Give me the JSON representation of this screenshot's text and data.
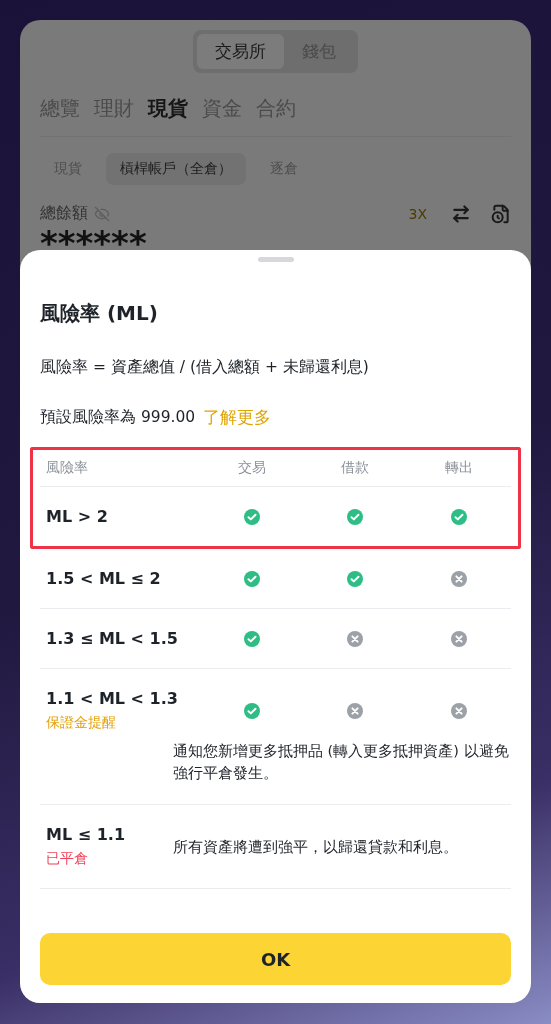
{
  "background_app": {
    "switch": [
      {
        "label": "交易所",
        "selected": true
      },
      {
        "label": "錢包",
        "selected": false
      }
    ],
    "tabs": [
      {
        "label": "總覽",
        "selected": false
      },
      {
        "label": "理財",
        "selected": false
      },
      {
        "label": "現貨",
        "selected": true
      },
      {
        "label": "資金",
        "selected": false
      },
      {
        "label": "合約",
        "selected": false
      }
    ],
    "subtabs": [
      {
        "label": "現貨",
        "selected": false
      },
      {
        "label": "槓桿帳戶（全倉）",
        "selected": true
      },
      {
        "label": "逐倉",
        "selected": false
      }
    ],
    "balance_label": "總餘額",
    "leverage": "3X",
    "balance": "******"
  },
  "sheet": {
    "title": "風險率 (ML)",
    "formula": "風險率 = 資產總值 / (借入總額 + 未歸還利息)",
    "default_text": "預設風險率為 999.00",
    "link": "了解更多",
    "table": {
      "columns": [
        "風險率",
        "交易",
        "借款",
        "轉出"
      ],
      "rows": [
        {
          "label": "ML > 2",
          "highlighted": true,
          "cells": [
            {
              "allowed": true
            },
            {
              "allowed": true
            },
            {
              "allowed": true
            }
          ]
        },
        {
          "label": "1.5 < ML ≤ 2",
          "highlighted": false,
          "cells": [
            {
              "allowed": true
            },
            {
              "allowed": true
            },
            {
              "allowed": false
            }
          ]
        },
        {
          "label": "1.3 ≤ ML < 1.5",
          "highlighted": false,
          "cells": [
            {
              "allowed": true
            },
            {
              "allowed": false
            },
            {
              "allowed": false
            }
          ]
        },
        {
          "label": "1.1 < ML < 1.3",
          "highlighted": false,
          "status": "保證金提醒",
          "color": "#e3a008",
          "cells": [
            {
              "allowed": true
            },
            {
              "allowed": false
            },
            {
              "allowed": false
            }
          ],
          "note": "通知您新增更多抵押品 (轉入更多抵押資產) 以避免強行平倉發生。"
        },
        {
          "label": "ML ≤ 1.1",
          "highlighted": false,
          "status": "已平倉",
          "color": "#f0415a",
          "note": "所有資產將遭到強平，以歸還貸款和利息。"
        }
      ]
    },
    "button": "OK"
  }
}
